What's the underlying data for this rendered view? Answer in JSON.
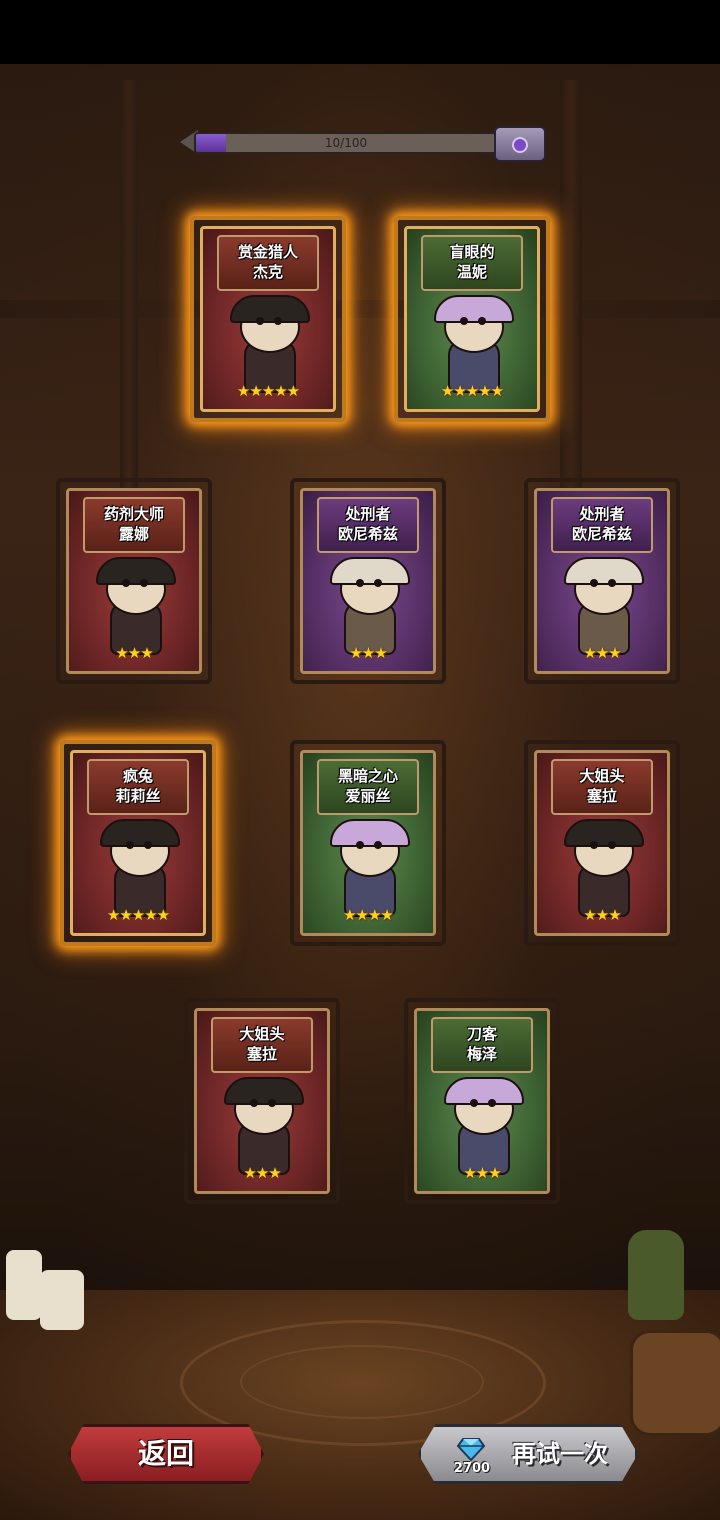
{
  "progress": {
    "text": "10/100",
    "fraction": 0.1,
    "fill_color": "#6a3db0"
  },
  "cards": [
    {
      "name1": "赏金猎人",
      "name2": "杰克",
      "stars": "★★★★★",
      "star_count": 5,
      "theme": "red",
      "glow": true
    },
    {
      "name1": "盲眼的",
      "name2": "温妮",
      "stars": "★★★★★",
      "star_count": 5,
      "theme": "green",
      "glow": true
    },
    {
      "name1": "药剂大师",
      "name2": "露娜",
      "stars": "★★★",
      "star_count": 3,
      "theme": "red",
      "glow": false
    },
    {
      "name1": "处刑者",
      "name2": "欧尼希兹",
      "stars": "★★★",
      "star_count": 3,
      "theme": "purple",
      "glow": false
    },
    {
      "name1": "处刑者",
      "name2": "欧尼希兹",
      "stars": "★★★",
      "star_count": 3,
      "theme": "purple",
      "glow": false
    },
    {
      "name1": "疯兔",
      "name2": "莉莉丝",
      "stars": "★★★★★",
      "star_count": 5,
      "theme": "red",
      "glow": true
    },
    {
      "name1": "黑暗之心",
      "name2": "爱丽丝",
      "stars": "★★★★",
      "star_count": 4,
      "theme": "green",
      "glow": false
    },
    {
      "name1": "大姐头",
      "name2": "塞拉",
      "stars": "★★★",
      "star_count": 3,
      "theme": "red",
      "glow": false
    },
    {
      "name1": "大姐头",
      "name2": "塞拉",
      "stars": "★★★",
      "star_count": 3,
      "theme": "red",
      "glow": false
    },
    {
      "name1": "刀客",
      "name2": "梅泽",
      "stars": "★★★",
      "star_count": 3,
      "theme": "green",
      "glow": false
    }
  ],
  "buttons": {
    "back": "返回",
    "retry": "再试一次",
    "retry_cost": "2700",
    "gem_icon": "diamond-gem-icon"
  },
  "colors": {
    "glow": "#ff9a1a",
    "star": "#ffd21e",
    "back_button": "#b0303a",
    "retry_button": "#a8a8ae"
  }
}
